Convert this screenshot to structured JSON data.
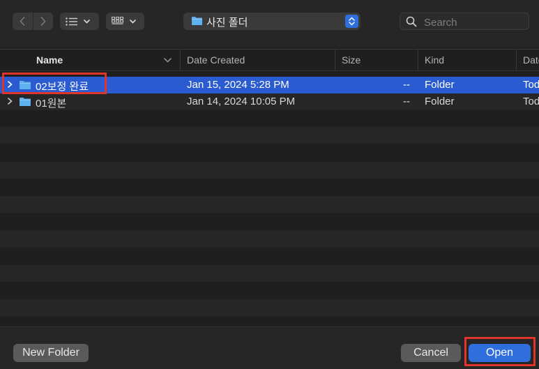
{
  "toolbar": {
    "path_label": "사진 폴더",
    "search_placeholder": "Search"
  },
  "columns": {
    "name": "Name",
    "date_created": "Date Created",
    "size": "Size",
    "kind": "Kind",
    "date_added": "Date"
  },
  "rows": [
    {
      "name": "02보정 완료",
      "date_created": "Jan 15, 2024 5:28 PM",
      "size": "--",
      "kind": "Folder",
      "date_added": "Tod",
      "selected": true
    },
    {
      "name": "01원본",
      "date_created": "Jan 14, 2024 10:05 PM",
      "size": "--",
      "kind": "Folder",
      "date_added": "Tod",
      "selected": false
    }
  ],
  "footer": {
    "new_folder_label": "New Folder",
    "cancel_label": "Cancel",
    "open_label": "Open"
  },
  "colors": {
    "accent": "#2f6fdd",
    "selection": "#2a5bd0",
    "highlight_box": "#e0352a",
    "folder": "#5fb2ef"
  },
  "icons": [
    "chevron-left-icon",
    "chevron-right-icon",
    "list-view-icon",
    "grid-view-icon",
    "folder-icon",
    "stepper-icon",
    "search-icon",
    "disclosure-icon"
  ]
}
